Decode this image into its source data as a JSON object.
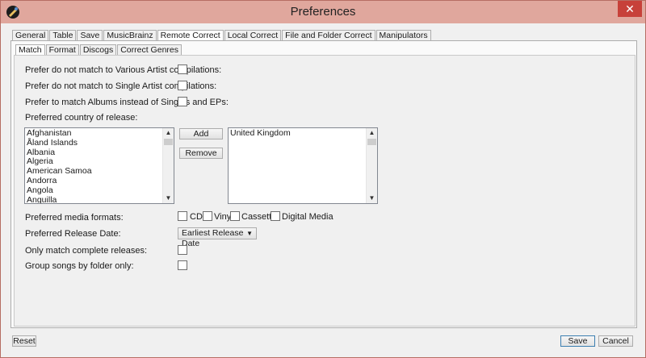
{
  "window": {
    "title": "Preferences",
    "app_icon": "app-icon",
    "close_icon": "close-icon"
  },
  "outer_tabs": [
    "General",
    "Table",
    "Save",
    "MusicBrainz",
    "Remote Correct",
    "Local Correct",
    "File and Folder Correct",
    "Manipulators"
  ],
  "outer_active": "Remote Correct",
  "inner_tabs": [
    "Match",
    "Format",
    "Discogs",
    "Correct Genres"
  ],
  "inner_active": "Match",
  "options": {
    "various_artist": "Prefer do not match to Various Artist compilations:",
    "single_artist": "Prefer do not match to Single Artist compilations:",
    "albums_over_singles": "Prefer to match Albums instead of Singles and EPs:",
    "preferred_country": "Preferred country of release:",
    "media_formats": "Preferred media formats:",
    "release_date": "Preferred Release Date:",
    "complete_releases": "Only match complete releases:",
    "group_by_folder": "Group songs by folder only:"
  },
  "country_list": [
    "Afghanistan",
    "Åland Islands",
    "Albania",
    "Algeria",
    "American Samoa",
    "Andorra",
    "Angola",
    "Anguilla"
  ],
  "selected_countries": [
    "United Kingdom"
  ],
  "buttons": {
    "add": "Add",
    "remove": "Remove",
    "reset": "Reset",
    "save": "Save",
    "cancel": "Cancel"
  },
  "media_formats": [
    "CD",
    "Vinyl",
    "Cassette",
    "Digital Media"
  ],
  "release_date_value": "Earliest Release Date",
  "colors": {
    "titlebar": "#e0a79d",
    "close": "#c7413a"
  }
}
